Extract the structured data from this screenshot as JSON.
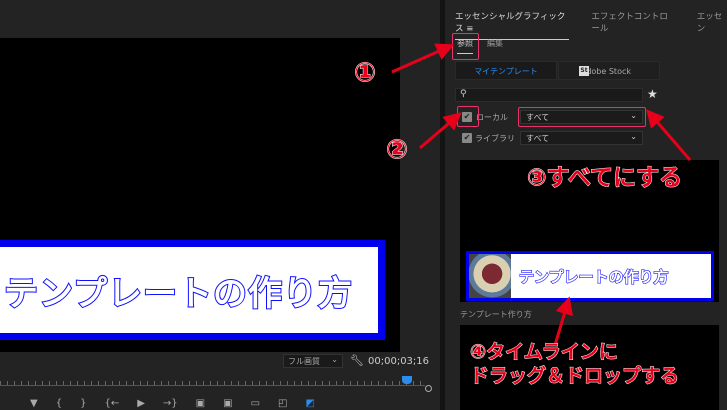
{
  "monitor": {
    "title_text": "テンプレートの作り方",
    "quality": "フル画質",
    "timecode": "00;00;03;16"
  },
  "transport_icons": [
    "marker-icon",
    "in-point-icon",
    "out-point-icon",
    "go-to-in-icon",
    "play-icon",
    "go-to-out-icon",
    "insert-icon",
    "overwrite-icon",
    "safe-margins-icon",
    "export-frame-icon",
    "comparison-icon"
  ],
  "panel": {
    "tabs": [
      {
        "label": "エッセンシャルグラフィックス"
      },
      {
        "label": "エフェクトコントロール"
      },
      {
        "label": "エッセン"
      }
    ],
    "menu_icon": "≡",
    "subtabs": [
      {
        "label": "参照"
      },
      {
        "label": "編集"
      }
    ],
    "source_tabs": {
      "my_templates": "マイテンプレート",
      "adobe_stock": "Adobe Stock",
      "stock_badge": "St"
    },
    "search": {
      "placeholder": ""
    },
    "filters": [
      {
        "label": "ローカル",
        "value": "すべて",
        "checked": true
      },
      {
        "label": "ライブラリ",
        "value": "すべて",
        "checked": true
      }
    ],
    "template_preview_text": "テンプレートの作り方",
    "template_name": "テンプレート作り方"
  },
  "annotations": {
    "a1": "①",
    "a2": "②",
    "a3": "③すべてにする",
    "a4_line1": "④タイムラインに",
    "a4_line2": "ドラッグ＆ドロップする"
  },
  "colors": {
    "accent": "#2d8ceb",
    "annotation": "#e8001a",
    "highlight": "#e8336a",
    "title_border": "#0000ee"
  }
}
